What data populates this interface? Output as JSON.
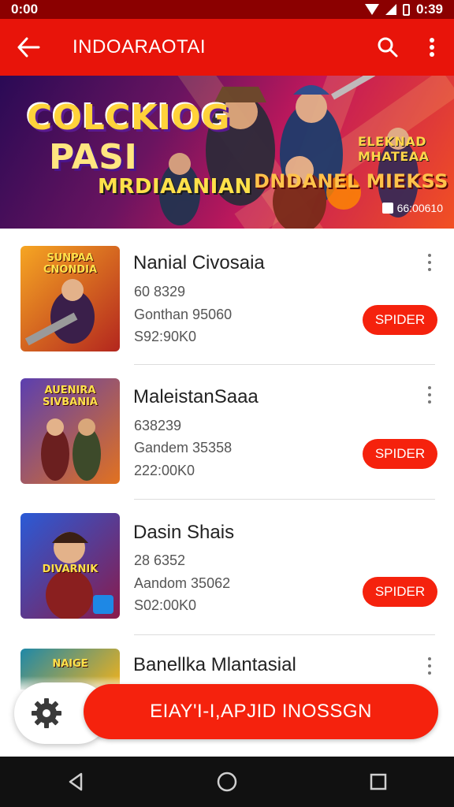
{
  "status_bar": {
    "time_left": "0:00",
    "time_right": "0:39"
  },
  "app_bar": {
    "title": "INDOARAOTAI",
    "icons": [
      "back-arrow",
      "search",
      "more-vertical"
    ]
  },
  "banner": {
    "title_line1": "COLCKIOG",
    "title_line2": "PASI",
    "subtitle": "MRDIAANIAN",
    "tag1": "DNDANEL MIEKSS",
    "tag2": "ELEKNAD MHATEAA",
    "count": "66:00610",
    "colors": {
      "start": "#2a0a55",
      "mid": "#c2185b",
      "end": "#f25022"
    }
  },
  "games": [
    {
      "title": "Nanial Civosaia",
      "line1": "60 8329",
      "line2": "Gonthan 95060",
      "line3": "S92:90K0",
      "button": "SPIDER",
      "thumb_text": "SUNPAA CNONDIA",
      "thumb_colors": [
        "#f6a623",
        "#b3261e"
      ]
    },
    {
      "title": "MaleistanSaaa",
      "line1": "638239",
      "line2": "Gandem 35358",
      "line3": "222:00K0",
      "button": "SPIDER",
      "thumb_text": "AUENIRA SIVBANIA",
      "thumb_colors": [
        "#5b3fb0",
        "#e2721f"
      ]
    },
    {
      "title": "Dasin Shais",
      "line1": "28 6352",
      "line2": "Aandom 35062",
      "line3": "S02:00K0",
      "button": "SPIDER",
      "thumb_text": "DIVARNIK",
      "thumb_colors": [
        "#2a5bd7",
        "#8a1a4a"
      ]
    },
    {
      "title": "Banellka Mlantasial",
      "thumb_text": "NAIGE",
      "thumb_colors": [
        "#1e88a8",
        "#f2b21b"
      ]
    }
  ],
  "footer": {
    "cta_label": "EIAY'I-I,APJID INOSSGN",
    "settings_icon": "gear-icon",
    "accent": "#f5220d"
  },
  "nav": {
    "icons": [
      "back-triangle",
      "home-circle",
      "recents-square"
    ]
  }
}
